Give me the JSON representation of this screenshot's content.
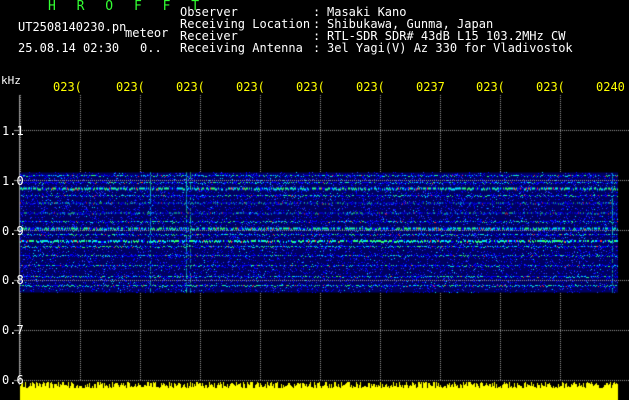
{
  "header": {
    "program": "H R O F F T",
    "filename": "UT2508140230.pn",
    "mode": "meteor",
    "datetime": "25.08.14 02:30",
    "count": "0.."
  },
  "info": [
    {
      "label": "Observer",
      "sep": ":",
      "value": "Masaki Kano"
    },
    {
      "label": "Receiving Location",
      "sep": ":",
      "value": "Shibukawa, Gunma, Japan"
    },
    {
      "label": "Receiver",
      "sep": ":",
      "value": "RTL-SDR SDR# 43dB L15 103.2MHz CW"
    },
    {
      "label": "Receiving Antenna",
      "sep": ":",
      "value": "3el Yagi(V) Az 330 for Vladivostok"
    }
  ],
  "time_axis": {
    "labels": [
      "023(",
      "023(",
      "023(",
      "023(",
      "023(",
      "023(",
      "0237",
      "023(",
      "023(",
      "0240"
    ]
  },
  "freq_axis": {
    "unit": "kHz",
    "labels": [
      "1.1",
      "1.0",
      "0.9",
      "0.8",
      "0.7",
      "0.6"
    ],
    "values": [
      1.1,
      1.0,
      0.9,
      0.8,
      0.7,
      0.6
    ]
  },
  "colors": {
    "background": "#000000",
    "program_title": "#33ff33",
    "time_labels": "#ffff00",
    "grid": "#9a9a9a",
    "signal_level": "#ffff00",
    "noise_low": "#000060",
    "noise_mid": "#0000ff",
    "signal_cyan": "#00e0ff",
    "signal_green": "#33ff66",
    "signal_red": "#ff3030"
  }
}
